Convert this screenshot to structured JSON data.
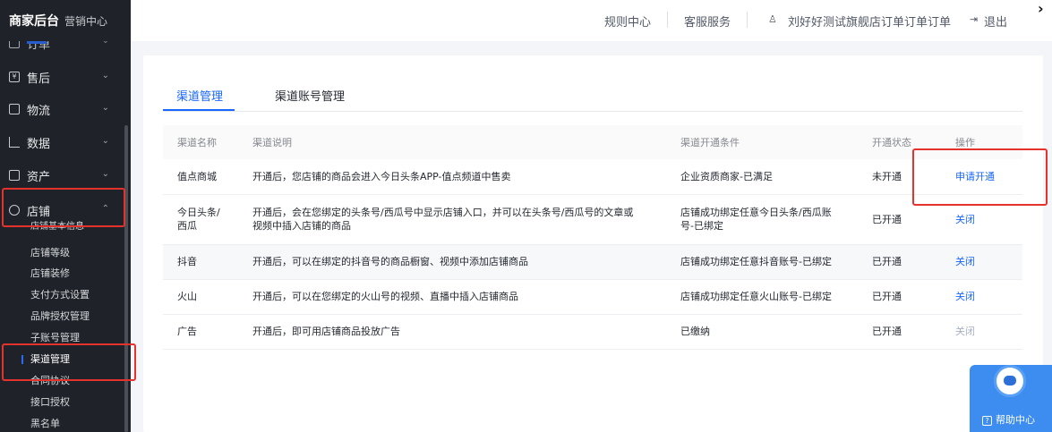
{
  "sidebar": {
    "brand": "商家后台",
    "subbrand": "营销中心",
    "partial_item": "订单",
    "items": [
      {
        "label": "售后",
        "icon": "after-sales-icon"
      },
      {
        "label": "物流",
        "icon": "truck-icon"
      },
      {
        "label": "数据",
        "icon": "chart-icon"
      },
      {
        "label": "资产",
        "icon": "wallet-icon"
      },
      {
        "label": "店铺",
        "icon": "store-icon"
      }
    ],
    "sub_items": [
      "店铺基本信息",
      "店铺等级",
      "店铺装修",
      "支付方式设置",
      "品牌授权管理",
      "子账号管理",
      "渠道管理",
      "合同协议",
      "接口授权",
      "黑名单"
    ],
    "active_sub": "渠道管理"
  },
  "topbar": {
    "rules": "规则中心",
    "service": "客服服务",
    "user": "刘好好测试旗舰店订单订单订单",
    "logout": "退出"
  },
  "tabs": [
    "渠道管理",
    "渠道账号管理"
  ],
  "table": {
    "headers": [
      "渠道名称",
      "渠道说明",
      "渠道开通条件",
      "开通状态",
      "操作"
    ],
    "rows": [
      {
        "name": "值点商城",
        "desc": "开通后，您店铺的商品会进入今日头条APP-值点频道中售卖",
        "cond": "企业资质商家-已满足",
        "status": "未开通",
        "op": "申请开通"
      },
      {
        "name": "今日头条/西瓜",
        "desc": "开通后，会在您绑定的头条号/西瓜号中显示店铺入口，并可以在头条号/西瓜号的文章或视频中插入店铺的商品",
        "cond": "店铺成功绑定任意今日头条/西瓜账号-已绑定",
        "status": "已开通",
        "op": "关闭"
      },
      {
        "name": "抖音",
        "desc": "开通后，可以在绑定的抖音号的商品橱窗、视频中添加店铺商品",
        "cond": "店铺成功绑定任意抖音账号-已绑定",
        "status": "已开通",
        "op": "关闭"
      },
      {
        "name": "火山",
        "desc": "开通后，可以在您绑定的火山号的视频、直播中插入店铺商品",
        "cond": "店铺成功绑定任意火山账号-已绑定",
        "status": "已开通",
        "op": "关闭"
      },
      {
        "name": "广告",
        "desc": "开通后，即可用店铺商品投放广告",
        "cond": "已缴纳",
        "status": "已开通",
        "op": "关闭"
      }
    ]
  },
  "help": {
    "label": "帮助中心"
  },
  "colors": {
    "accent": "#1966ff",
    "highlight": "#e5322d",
    "sidebar_bg": "#1f2228"
  }
}
